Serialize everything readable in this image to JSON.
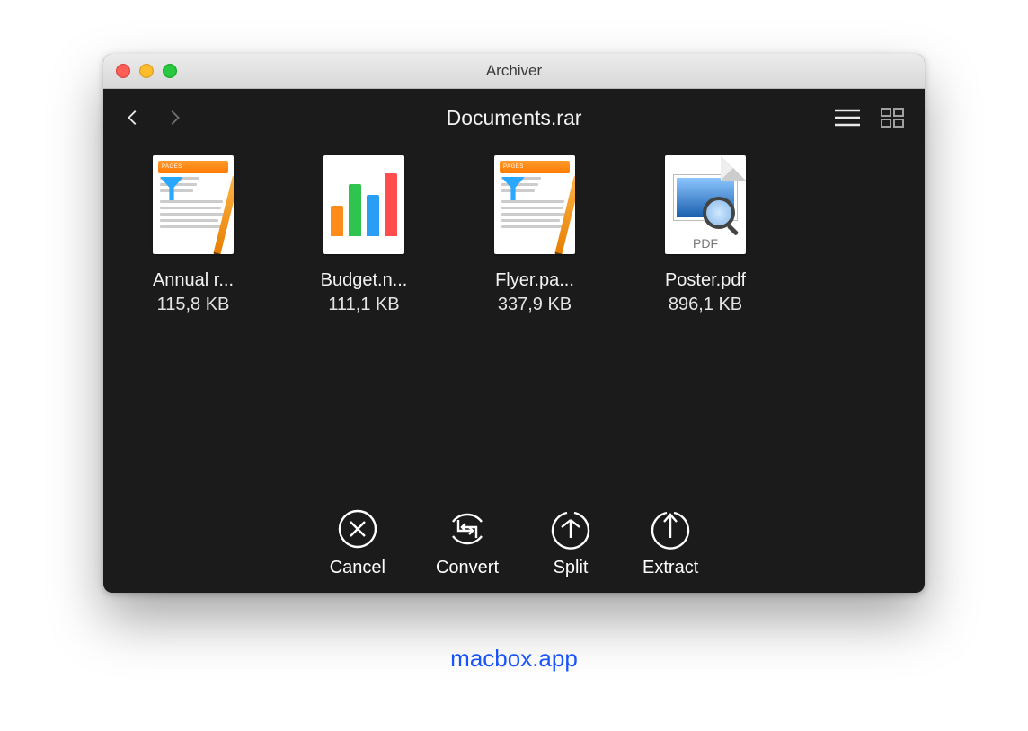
{
  "window": {
    "title": "Archiver"
  },
  "toolbar": {
    "archive_name": "Documents.rar"
  },
  "files": [
    {
      "name": "Annual r...",
      "size": "115,8 KB",
      "icon": "pages-icon"
    },
    {
      "name": "Budget.n...",
      "size": "111,1 KB",
      "icon": "numbers-icon"
    },
    {
      "name": "Flyer.pa...",
      "size": "337,9 KB",
      "icon": "pages-icon"
    },
    {
      "name": "Poster.pdf",
      "size": "896,1 KB",
      "icon": "pdf-icon",
      "pdf_label": "PDF"
    }
  ],
  "actions": {
    "cancel": "Cancel",
    "convert": "Convert",
    "split": "Split",
    "extract": "Extract"
  },
  "watermark": "macbox.app"
}
